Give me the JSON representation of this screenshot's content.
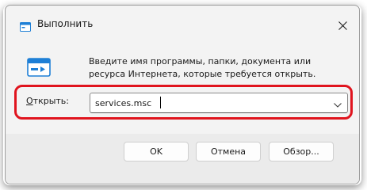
{
  "window": {
    "title": "Выполнить",
    "description": "Введите имя программы, папки, документа или ресурса Интернета, которые требуется открыть."
  },
  "open": {
    "label_underlined": "О",
    "label_rest": "ткрыть:",
    "value": "services.msc"
  },
  "buttons": {
    "ok": "OK",
    "cancel": "Отмена",
    "browse": "Обзор..."
  },
  "icons": {
    "app": "run-app-icon",
    "close": "close-icon",
    "run": "run-dialog-icon",
    "dropdown": "chevron-down-icon"
  },
  "colors": {
    "highlight": "#e0141e",
    "icon_blue": "#1e7fd6"
  }
}
